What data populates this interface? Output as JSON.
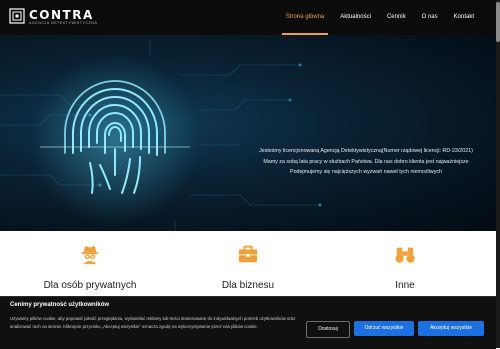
{
  "header": {
    "logo_text": "CONTRA",
    "logo_subtitle": "AGENCJA DETEKTYWISTYCZNA",
    "nav": [
      {
        "label": "Strona główna",
        "active": true
      },
      {
        "label": "Aktualności",
        "active": false
      },
      {
        "label": "Cennik",
        "active": false
      },
      {
        "label": "O nas",
        "active": false
      },
      {
        "label": "Kontakt",
        "active": false
      }
    ]
  },
  "hero": {
    "line1": "Jesteśmy licencjonowaną Agencją Detektywistyczną(Numer rządowej licencji:  RD-23/2021)",
    "line2": "Mamy  za sobą lata pracy w służbach Państwa. Dla nas dobro klienta jest najważniejsze",
    "line3": "Podejmujemy  się najcięższych wyzwań nawet tych niemożliwych"
  },
  "services": [
    {
      "label": "Dla osób prywatnych",
      "icon": "detective-icon"
    },
    {
      "label": "Dla biznesu",
      "icon": "briefcase-icon"
    },
    {
      "label": "Inne",
      "icon": "binoculars-icon"
    }
  ],
  "cookie": {
    "title": "Cenimy prywatność użytkowników",
    "text": "Używamy plików cookie, aby poprawić jakość przeglądania, wyświetlać reklamy lub treści dostosowane do indywidualnych potrzeb użytkowników oraz analizować ruch na stronie. Kliknięcie przycisku „Akceptuj wszystkie” oznacza zgodę na wykorzystywanie przez nas plików cookie.",
    "customize_label": "Dostosuj",
    "reject_label": "Odrzuć wszystkie",
    "accept_label": "Akceptuj wszystkie"
  },
  "colors": {
    "accent": "#f0a13a",
    "button_blue": "#1d70e0",
    "header_bg": "#0b0b0b"
  }
}
